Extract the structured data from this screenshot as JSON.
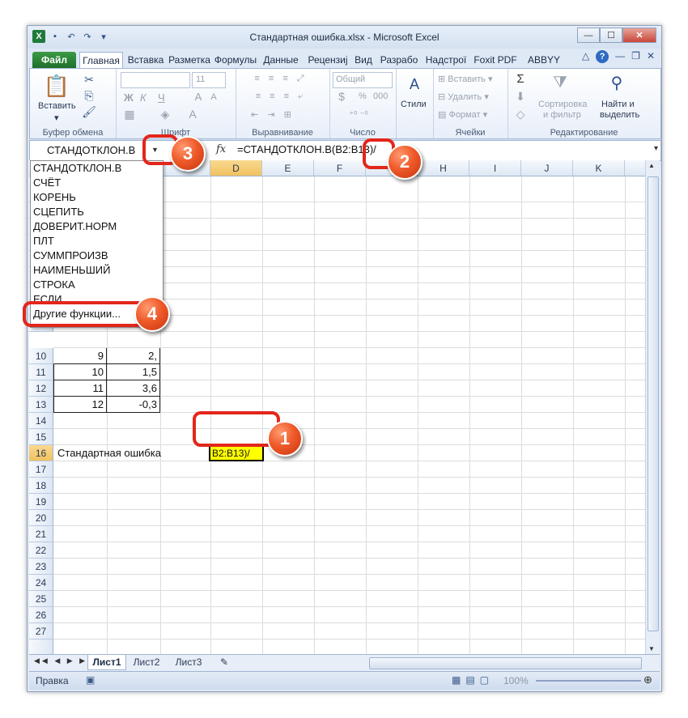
{
  "window": {
    "title": "Стандартная ошибка.xlsx  -  Microsoft Excel"
  },
  "tabs": [
    "Файл",
    "Главная",
    "Вставка",
    "Разметка",
    "Формулы",
    "Данные",
    "Рецензиј",
    "Вид",
    "Разрабо",
    "Надстрої",
    "Foxit PDF",
    "ABBYY PD"
  ],
  "ribbon": {
    "paste_label": "Вставить",
    "clipboard_group": "Буфер обмена",
    "font_group": "Шрифт",
    "font_size": "11",
    "bold": "Ж",
    "italic": "К",
    "underline": "Ч",
    "alignment_group": "Выравнивание",
    "number_format": "Общий",
    "number_group": "Число",
    "percent": "%",
    "thousands": "000",
    "styles_label": "Стили",
    "insert_label": "Вставить",
    "delete_label": "Удалить",
    "format_label": "Формат",
    "cells_group": "Ячейки",
    "sort_label_1": "Сортировка",
    "sort_label_2": "и фильтр",
    "find_label_1": "Найти и",
    "find_label_2": "выделить",
    "editing_group": "Редактирование"
  },
  "formula_bar": {
    "name_box": "СТАНДОТКЛОН.В",
    "fx": "fx",
    "formula": "=СТАНДОТКЛОН.В(В2:В13)/"
  },
  "columns": [
    "D",
    "E",
    "F",
    "G",
    "H",
    "I",
    "J",
    "K"
  ],
  "partial_column": "C",
  "rows": [
    "10",
    "11",
    "12",
    "13",
    "14",
    "15",
    "16",
    "17",
    "18",
    "19",
    "20",
    "21",
    "22",
    "23",
    "24",
    "25",
    "26",
    "27"
  ],
  "cells": {
    "r10": {
      "b": "9",
      "c": "2,"
    },
    "r11": {
      "b": "10",
      "c": "1,5"
    },
    "r12": {
      "b": "11",
      "c": "3,6"
    },
    "r13": {
      "b": "12",
      "c": "-0,3"
    },
    "r16_label": "Стандартная ошибка",
    "r16_active": "В2:В13)/"
  },
  "function_list": [
    "СТАНДОТКЛОН.В",
    "СЧЁТ",
    "КОРЕНЬ",
    "СЦЕПИТЬ",
    "ДОВЕРИТ.НОРМ",
    "ПЛТ",
    "СУММПРОИЗВ",
    "НАИМЕНЬШИЙ",
    "СТРОКА",
    "ЕСЛИ",
    "Другие функции..."
  ],
  "sheets": [
    "Лист1",
    "Лист2",
    "Лист3"
  ],
  "status": {
    "mode": "Правка",
    "zoom": "100%"
  },
  "callouts": [
    "1",
    "2",
    "3",
    "4"
  ],
  "colors": {
    "accent_green": "#1e6f2b",
    "active_cell": "#ffff00",
    "callout": "#ef5a2a",
    "callout_ring": "#e3261b"
  }
}
